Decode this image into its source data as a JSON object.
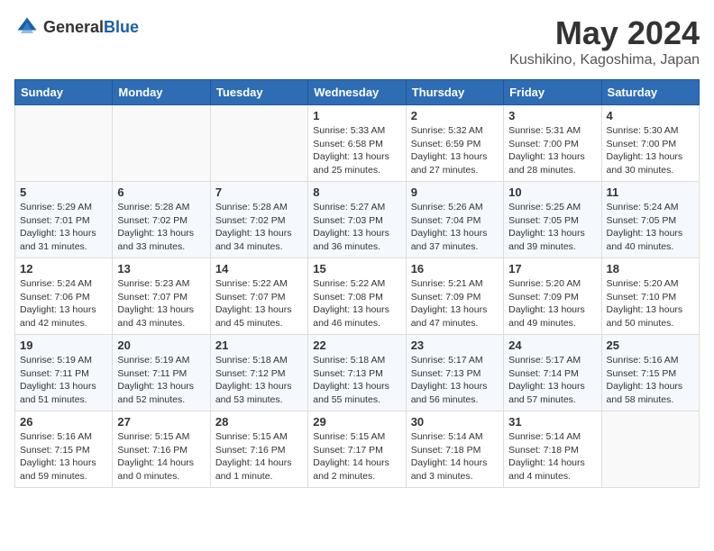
{
  "logo": {
    "text_general": "General",
    "text_blue": "Blue"
  },
  "title": {
    "month_year": "May 2024",
    "location": "Kushikino, Kagoshima, Japan"
  },
  "headers": [
    "Sunday",
    "Monday",
    "Tuesday",
    "Wednesday",
    "Thursday",
    "Friday",
    "Saturday"
  ],
  "weeks": [
    [
      {
        "day": "",
        "info": ""
      },
      {
        "day": "",
        "info": ""
      },
      {
        "day": "",
        "info": ""
      },
      {
        "day": "1",
        "info": "Sunrise: 5:33 AM\nSunset: 6:58 PM\nDaylight: 13 hours\nand 25 minutes."
      },
      {
        "day": "2",
        "info": "Sunrise: 5:32 AM\nSunset: 6:59 PM\nDaylight: 13 hours\nand 27 minutes."
      },
      {
        "day": "3",
        "info": "Sunrise: 5:31 AM\nSunset: 7:00 PM\nDaylight: 13 hours\nand 28 minutes."
      },
      {
        "day": "4",
        "info": "Sunrise: 5:30 AM\nSunset: 7:00 PM\nDaylight: 13 hours\nand 30 minutes."
      }
    ],
    [
      {
        "day": "5",
        "info": "Sunrise: 5:29 AM\nSunset: 7:01 PM\nDaylight: 13 hours\nand 31 minutes."
      },
      {
        "day": "6",
        "info": "Sunrise: 5:28 AM\nSunset: 7:02 PM\nDaylight: 13 hours\nand 33 minutes."
      },
      {
        "day": "7",
        "info": "Sunrise: 5:28 AM\nSunset: 7:02 PM\nDaylight: 13 hours\nand 34 minutes."
      },
      {
        "day": "8",
        "info": "Sunrise: 5:27 AM\nSunset: 7:03 PM\nDaylight: 13 hours\nand 36 minutes."
      },
      {
        "day": "9",
        "info": "Sunrise: 5:26 AM\nSunset: 7:04 PM\nDaylight: 13 hours\nand 37 minutes."
      },
      {
        "day": "10",
        "info": "Sunrise: 5:25 AM\nSunset: 7:05 PM\nDaylight: 13 hours\nand 39 minutes."
      },
      {
        "day": "11",
        "info": "Sunrise: 5:24 AM\nSunset: 7:05 PM\nDaylight: 13 hours\nand 40 minutes."
      }
    ],
    [
      {
        "day": "12",
        "info": "Sunrise: 5:24 AM\nSunset: 7:06 PM\nDaylight: 13 hours\nand 42 minutes."
      },
      {
        "day": "13",
        "info": "Sunrise: 5:23 AM\nSunset: 7:07 PM\nDaylight: 13 hours\nand 43 minutes."
      },
      {
        "day": "14",
        "info": "Sunrise: 5:22 AM\nSunset: 7:07 PM\nDaylight: 13 hours\nand 45 minutes."
      },
      {
        "day": "15",
        "info": "Sunrise: 5:22 AM\nSunset: 7:08 PM\nDaylight: 13 hours\nand 46 minutes."
      },
      {
        "day": "16",
        "info": "Sunrise: 5:21 AM\nSunset: 7:09 PM\nDaylight: 13 hours\nand 47 minutes."
      },
      {
        "day": "17",
        "info": "Sunrise: 5:20 AM\nSunset: 7:09 PM\nDaylight: 13 hours\nand 49 minutes."
      },
      {
        "day": "18",
        "info": "Sunrise: 5:20 AM\nSunset: 7:10 PM\nDaylight: 13 hours\nand 50 minutes."
      }
    ],
    [
      {
        "day": "19",
        "info": "Sunrise: 5:19 AM\nSunset: 7:11 PM\nDaylight: 13 hours\nand 51 minutes."
      },
      {
        "day": "20",
        "info": "Sunrise: 5:19 AM\nSunset: 7:11 PM\nDaylight: 13 hours\nand 52 minutes."
      },
      {
        "day": "21",
        "info": "Sunrise: 5:18 AM\nSunset: 7:12 PM\nDaylight: 13 hours\nand 53 minutes."
      },
      {
        "day": "22",
        "info": "Sunrise: 5:18 AM\nSunset: 7:13 PM\nDaylight: 13 hours\nand 55 minutes."
      },
      {
        "day": "23",
        "info": "Sunrise: 5:17 AM\nSunset: 7:13 PM\nDaylight: 13 hours\nand 56 minutes."
      },
      {
        "day": "24",
        "info": "Sunrise: 5:17 AM\nSunset: 7:14 PM\nDaylight: 13 hours\nand 57 minutes."
      },
      {
        "day": "25",
        "info": "Sunrise: 5:16 AM\nSunset: 7:15 PM\nDaylight: 13 hours\nand 58 minutes."
      }
    ],
    [
      {
        "day": "26",
        "info": "Sunrise: 5:16 AM\nSunset: 7:15 PM\nDaylight: 13 hours\nand 59 minutes."
      },
      {
        "day": "27",
        "info": "Sunrise: 5:15 AM\nSunset: 7:16 PM\nDaylight: 14 hours\nand 0 minutes."
      },
      {
        "day": "28",
        "info": "Sunrise: 5:15 AM\nSunset: 7:16 PM\nDaylight: 14 hours\nand 1 minute."
      },
      {
        "day": "29",
        "info": "Sunrise: 5:15 AM\nSunset: 7:17 PM\nDaylight: 14 hours\nand 2 minutes."
      },
      {
        "day": "30",
        "info": "Sunrise: 5:14 AM\nSunset: 7:18 PM\nDaylight: 14 hours\nand 3 minutes."
      },
      {
        "day": "31",
        "info": "Sunrise: 5:14 AM\nSunset: 7:18 PM\nDaylight: 14 hours\nand 4 minutes."
      },
      {
        "day": "",
        "info": ""
      }
    ]
  ]
}
